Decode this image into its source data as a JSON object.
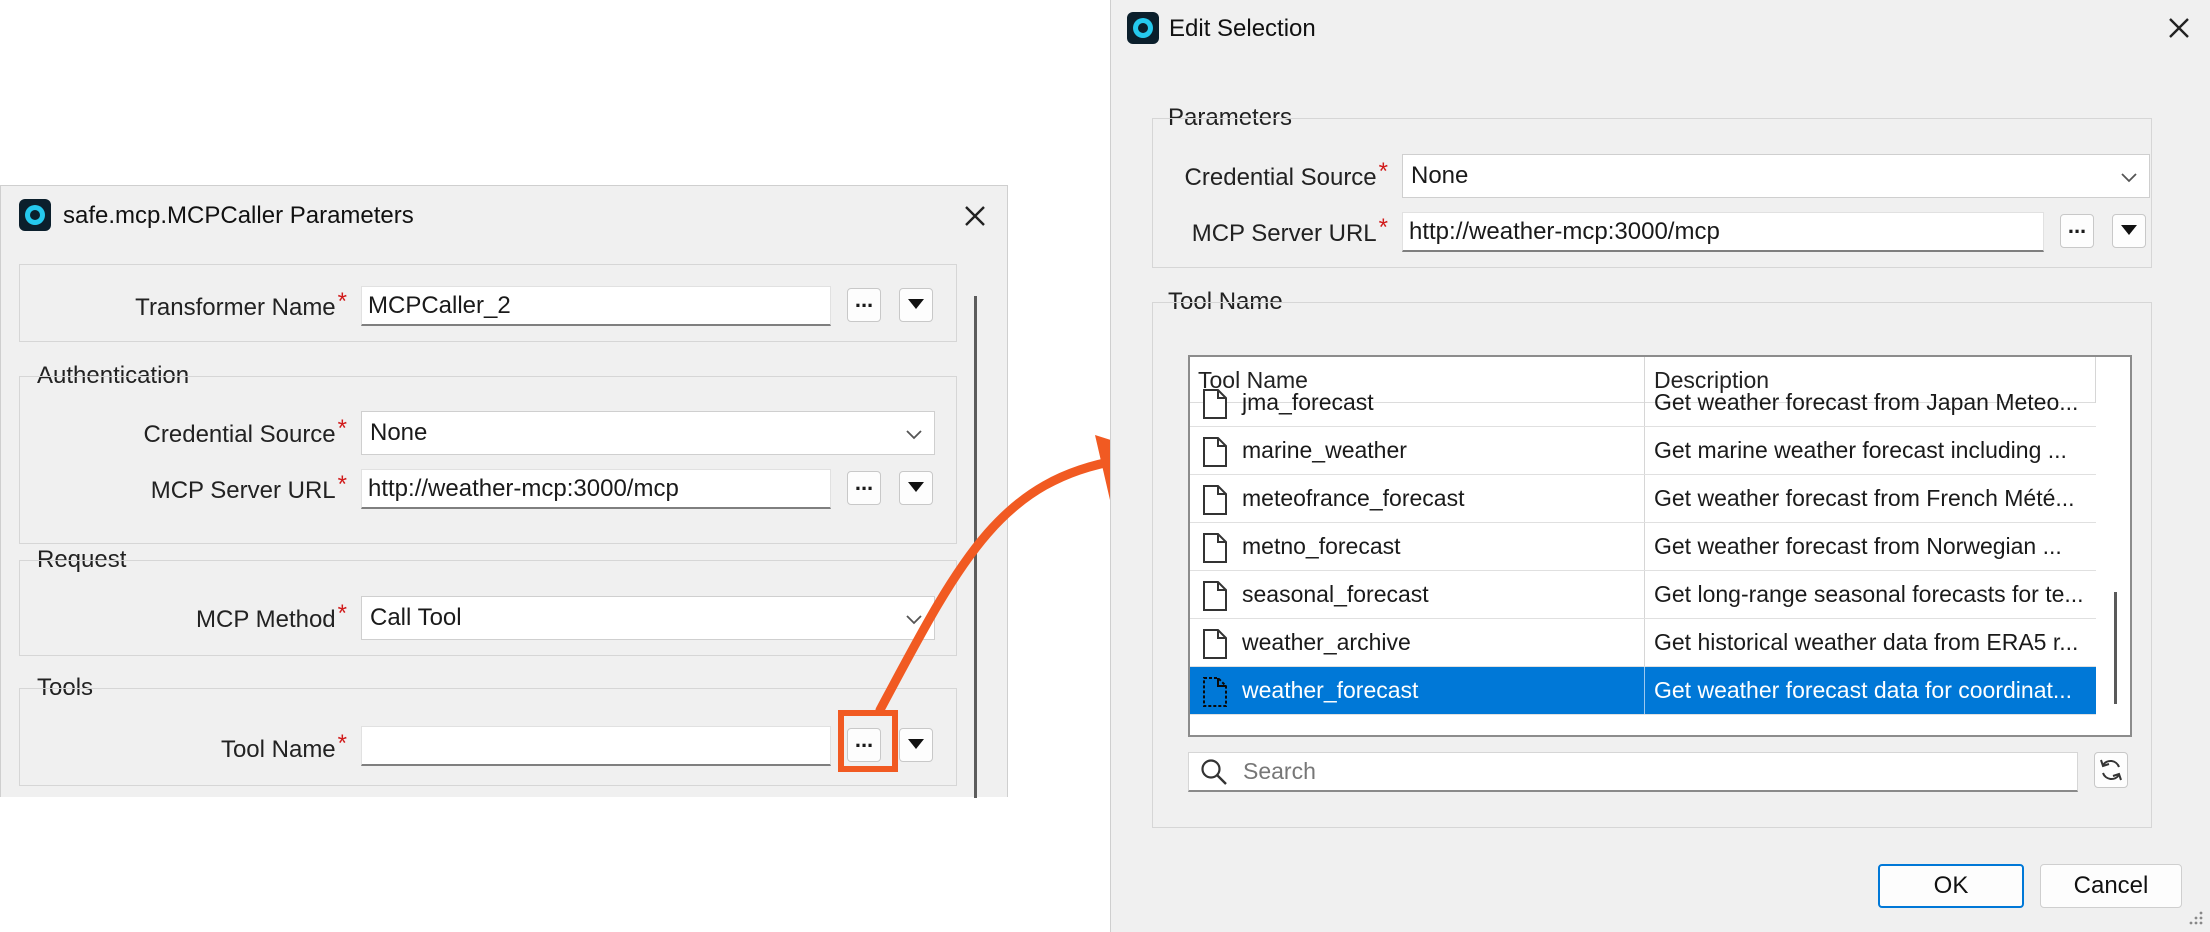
{
  "left_window": {
    "title": "safe.mcp.MCPCaller Parameters",
    "transformer_name": {
      "label": "Transformer Name",
      "value": "MCPCaller_2"
    },
    "authentication": {
      "group_title": "Authentication",
      "credential_source": {
        "label": "Credential Source",
        "value": "None"
      },
      "server_url": {
        "label": "MCP Server URL",
        "value": "http://weather-mcp:3000/mcp"
      }
    },
    "request": {
      "group_title": "Request",
      "method": {
        "label": "MCP Method",
        "value": "Call Tool"
      }
    },
    "tools": {
      "group_title": "Tools",
      "tool_name": {
        "label": "Tool Name",
        "value": ""
      }
    },
    "dots_label": "...",
    "required_mark": "*"
  },
  "right_window": {
    "title": "Edit Selection",
    "parameters": {
      "group_title": "Parameters",
      "credential_source": {
        "label": "Credential Source",
        "value": "None"
      },
      "server_url": {
        "label": "MCP Server URL",
        "value": "http://weather-mcp:3000/mcp"
      }
    },
    "tool_group_title": "Tool Name",
    "table": {
      "columns": [
        "Tool Name",
        "Description"
      ],
      "rows": [
        {
          "name": "jma_forecast",
          "description": "Get weather forecast from Japan Meteo..."
        },
        {
          "name": "marine_weather",
          "description": "Get marine weather forecast including ..."
        },
        {
          "name": "meteofrance_forecast",
          "description": "Get weather forecast from French Mété..."
        },
        {
          "name": "metno_forecast",
          "description": "Get weather forecast from Norwegian ..."
        },
        {
          "name": "seasonal_forecast",
          "description": "Get long-range seasonal forecasts for te..."
        },
        {
          "name": "weather_archive",
          "description": "Get historical weather data from ERA5 r..."
        },
        {
          "name": "weather_forecast",
          "description": "Get weather forecast data for coordinat..."
        }
      ],
      "selected_index": 6
    },
    "search": {
      "placeholder": "Search",
      "value": ""
    },
    "ok_label": "OK",
    "cancel_label": "Cancel"
  },
  "colors": {
    "accent_selection": "#0078d7",
    "highlight_arrow": "#f15a22",
    "required": "#d11a1a"
  }
}
